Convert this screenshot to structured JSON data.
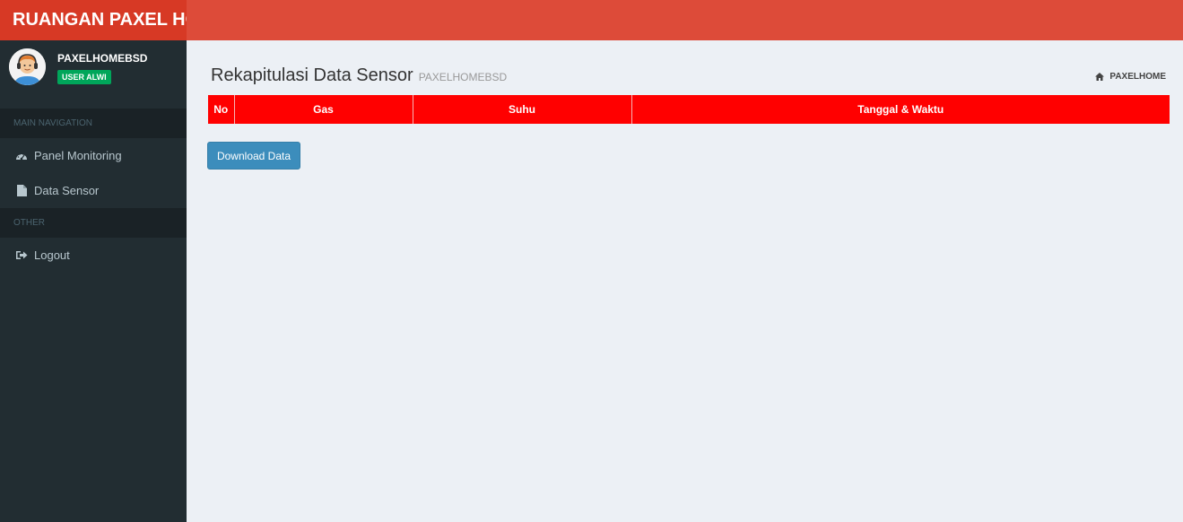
{
  "brand": {
    "title": "RUANGAN PAXEL HOME"
  },
  "user": {
    "name": "PAXELHOMEBSD",
    "badge": "USER ALWI"
  },
  "sidebar": {
    "main_header": "MAIN NAVIGATION",
    "items": [
      {
        "label": "Panel Monitoring",
        "icon": "dashboard-icon"
      },
      {
        "label": "Data Sensor",
        "icon": "file-icon"
      }
    ],
    "other_header": "OTHER",
    "other_items": [
      {
        "label": "Logout",
        "icon": "sign-out-icon"
      }
    ]
  },
  "page": {
    "title": "Rekapitulasi Data Sensor",
    "subtitle": "PAXELHOMEBSD",
    "breadcrumb": "PAXELHOME"
  },
  "table": {
    "columns": [
      "No",
      "Gas",
      "Suhu",
      "Tanggal & Waktu"
    ],
    "rows": []
  },
  "actions": {
    "download_label": "Download Data"
  },
  "colors": {
    "topbar": "#dd4b39",
    "brand": "#d73925",
    "sidebar": "#222d32",
    "table_header": "#ff0000",
    "button": "#3c8dbc",
    "badge": "#00a65a"
  }
}
